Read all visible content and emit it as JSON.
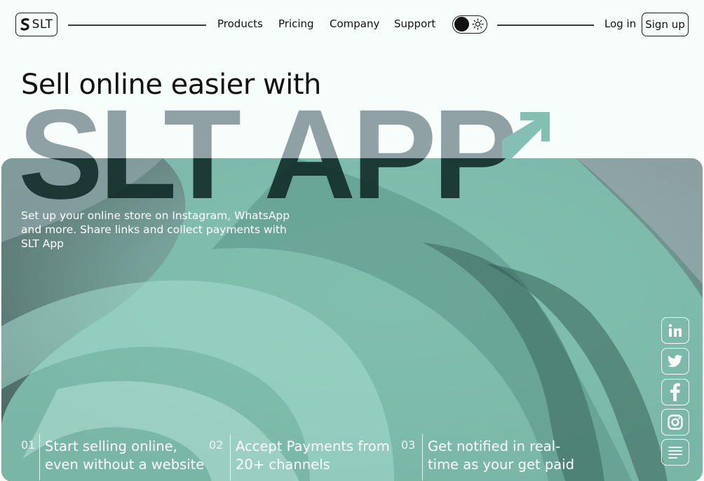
{
  "header": {
    "logo_text": "SLT",
    "nav": [
      "Products",
      "Pricing",
      "Company",
      "Support"
    ],
    "theme_toggle": "dark",
    "login_label": "Log in",
    "signup_label": "Sign up"
  },
  "hero": {
    "headline": "Sell online easier with",
    "big_word": "SLT APP",
    "subtitle": "Set up your online store on Instagram, WhatsApp and more. Share links and collect payments with SLT App"
  },
  "social": [
    "linkedin-icon",
    "twitter-icon",
    "facebook-icon",
    "instagram-icon",
    "menu-icon"
  ],
  "features": [
    {
      "num": "01",
      "line1": "Start selling online,",
      "line2": "even without a website"
    },
    {
      "num": "02",
      "line1": "Accept Payments from",
      "line2": "20+ channels"
    },
    {
      "num": "03",
      "line1": "Get notified in real-",
      "line2": "time as your get paid"
    }
  ],
  "colors": {
    "background": "#f7fdfb",
    "accent_mint": "#7fbfb0",
    "text_dark": "#111111"
  }
}
